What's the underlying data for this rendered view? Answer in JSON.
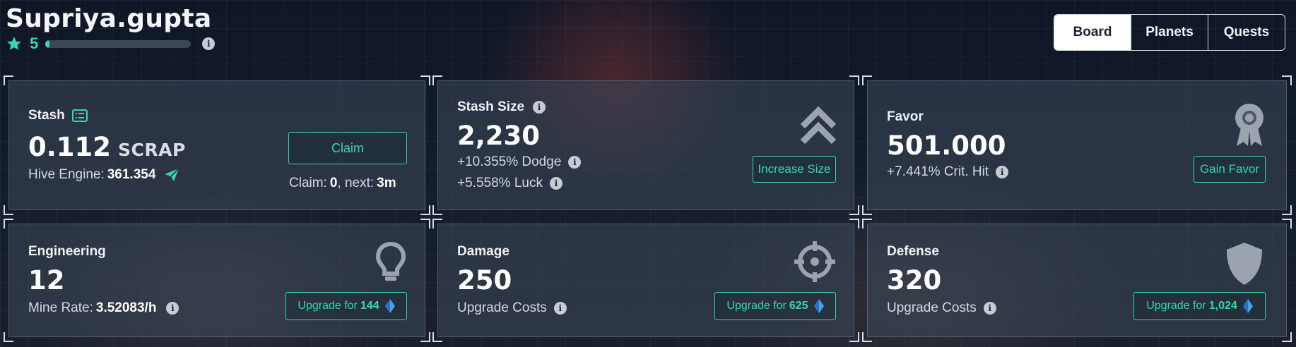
{
  "profile": {
    "username": "Supriya.gupta",
    "level": "5",
    "xp_progress": 0.03
  },
  "tabs": [
    {
      "label": "Board",
      "active": true
    },
    {
      "label": "Planets",
      "active": false
    },
    {
      "label": "Quests",
      "active": false
    }
  ],
  "stash": {
    "label": "Stash",
    "value": "0.112",
    "unit": "SCRAP",
    "hive_label": "Hive Engine:",
    "hive_value": "361.354",
    "claim_button": "Claim",
    "claim_label": "Claim:",
    "claim_value": "0",
    "next_label": ", next:",
    "next_value": "3m"
  },
  "stash_size": {
    "label": "Stash Size",
    "value": "2,230",
    "dodge_value": "+10.355%",
    "dodge_label": "Dodge",
    "luck_value": "+5.558%",
    "luck_label": "Luck",
    "button": "Increase Size"
  },
  "favor": {
    "label": "Favor",
    "value": "501.000",
    "crit_value": "+7.441%",
    "crit_label": "Crit. Hit",
    "button": "Gain Favor"
  },
  "engineering": {
    "label": "Engineering",
    "value": "12",
    "rate_label": "Mine Rate:",
    "rate_value": "3.52083/h",
    "button_label": "Upgrade for",
    "button_cost": "144"
  },
  "damage": {
    "label": "Damage",
    "value": "250",
    "sub_label": "Upgrade Costs",
    "button_label": "Upgrade for",
    "button_cost": "625"
  },
  "defense": {
    "label": "Defense",
    "value": "320",
    "sub_label": "Upgrade Costs",
    "button_label": "Upgrade for",
    "button_cost": "1,024"
  },
  "icons": {
    "info": "i",
    "accent_color": "#3ad6a8"
  }
}
